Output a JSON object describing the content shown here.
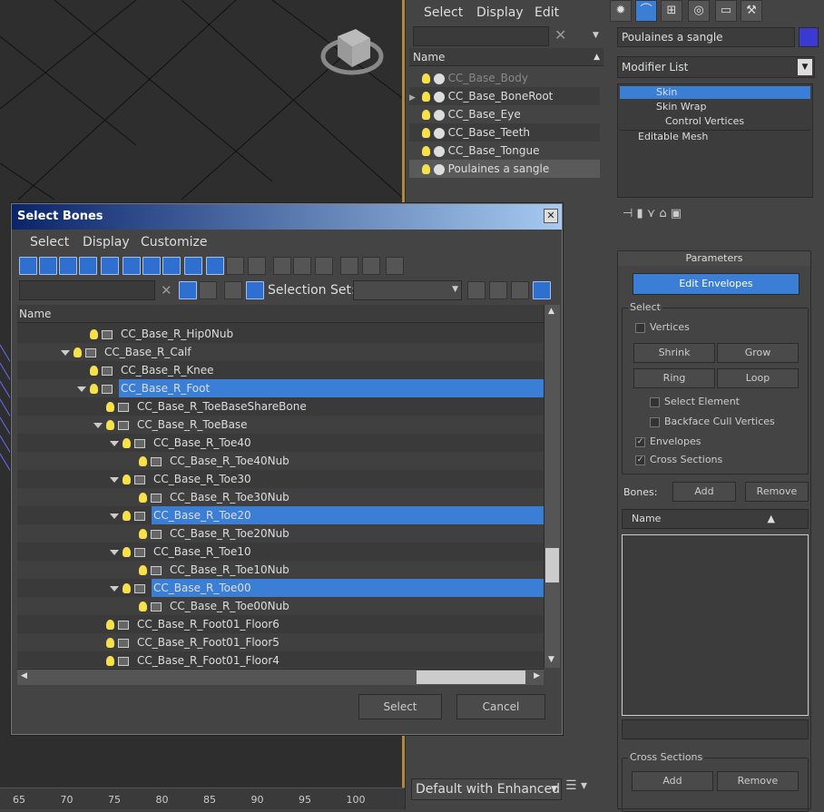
{
  "scene_explorer": {
    "menu": [
      "Select",
      "Display",
      "Edit"
    ],
    "column_name": "Name",
    "items": [
      {
        "label": "CC_Base_Body",
        "dim": true
      },
      {
        "label": "CC_Base_BoneRoot",
        "dim": false
      },
      {
        "label": "CC_Base_Eye",
        "dim": false
      },
      {
        "label": "CC_Base_Teeth",
        "dim": false
      },
      {
        "label": "CC_Base_Tongue",
        "dim": false
      },
      {
        "label": "Poulaines a sangle",
        "dim": false
      }
    ],
    "layer_dropdown": "Default with Enhanced"
  },
  "modifier_panel": {
    "object_name": "Poulaines a sangle",
    "object_color": "#3a3ad2",
    "modifier_list": "Modifier List",
    "stack": [
      "Skin",
      "Skin Wrap",
      "Control Vertices",
      "Editable Mesh"
    ],
    "parameters_title": "Parameters",
    "edit_envelopes": "Edit Envelopes",
    "select_group": "Select",
    "vertices": "Vertices",
    "shrink": "Shrink",
    "grow": "Grow",
    "ring": "Ring",
    "loop": "Loop",
    "select_element": "Select Element",
    "backface_cull": "Backface Cull Vertices",
    "envelopes": "Envelopes",
    "cross_sections_chk": "Cross Sections",
    "bones_label": "Bones:",
    "add": "Add",
    "remove": "Remove",
    "name_col": "Name",
    "cross_sections_group": "Cross Sections",
    "cs_add": "Add",
    "cs_remove": "Remove"
  },
  "dialog": {
    "title": "Select Bones",
    "menu": [
      "Select",
      "Display",
      "Customize"
    ],
    "selection_set_label": "Selection Set:",
    "column_name": "Name",
    "rows": [
      {
        "label": "CC_Base_R_Hip0Nub",
        "indent": 6,
        "expand": false,
        "selected": false
      },
      {
        "label": "CC_Base_R_Calf",
        "indent": 5,
        "expand": true,
        "selected": false
      },
      {
        "label": "CC_Base_R_Knee",
        "indent": 6,
        "expand": false,
        "selected": false
      },
      {
        "label": "CC_Base_R_Foot",
        "indent": 6,
        "expand": true,
        "selected": true
      },
      {
        "label": "CC_Base_R_ToeBaseShareBone",
        "indent": 7,
        "expand": false,
        "selected": false
      },
      {
        "label": "CC_Base_R_ToeBase",
        "indent": 7,
        "expand": true,
        "selected": false
      },
      {
        "label": "CC_Base_R_Toe40",
        "indent": 8,
        "expand": true,
        "selected": false
      },
      {
        "label": "CC_Base_R_Toe40Nub",
        "indent": 9,
        "expand": false,
        "selected": false
      },
      {
        "label": "CC_Base_R_Toe30",
        "indent": 8,
        "expand": true,
        "selected": false
      },
      {
        "label": "CC_Base_R_Toe30Nub",
        "indent": 9,
        "expand": false,
        "selected": false
      },
      {
        "label": "CC_Base_R_Toe20",
        "indent": 8,
        "expand": true,
        "selected": true
      },
      {
        "label": "CC_Base_R_Toe20Nub",
        "indent": 9,
        "expand": false,
        "selected": false
      },
      {
        "label": "CC_Base_R_Toe10",
        "indent": 8,
        "expand": true,
        "selected": false
      },
      {
        "label": "CC_Base_R_Toe10Nub",
        "indent": 9,
        "expand": false,
        "selected": false
      },
      {
        "label": "CC_Base_R_Toe00",
        "indent": 8,
        "expand": true,
        "selected": true
      },
      {
        "label": "CC_Base_R_Toe00Nub",
        "indent": 9,
        "expand": false,
        "selected": false
      },
      {
        "label": "CC_Base_R_Foot01_Floor6",
        "indent": 7,
        "expand": false,
        "selected": false
      },
      {
        "label": "CC_Base_R_Foot01_Floor5",
        "indent": 7,
        "expand": false,
        "selected": false
      },
      {
        "label": "CC_Base_R_Foot01_Floor4",
        "indent": 7,
        "expand": false,
        "selected": false
      }
    ],
    "select_button": "Select",
    "cancel_button": "Cancel"
  },
  "ruler": [
    "65",
    "70",
    "75",
    "80",
    "85",
    "90",
    "95",
    "100"
  ]
}
